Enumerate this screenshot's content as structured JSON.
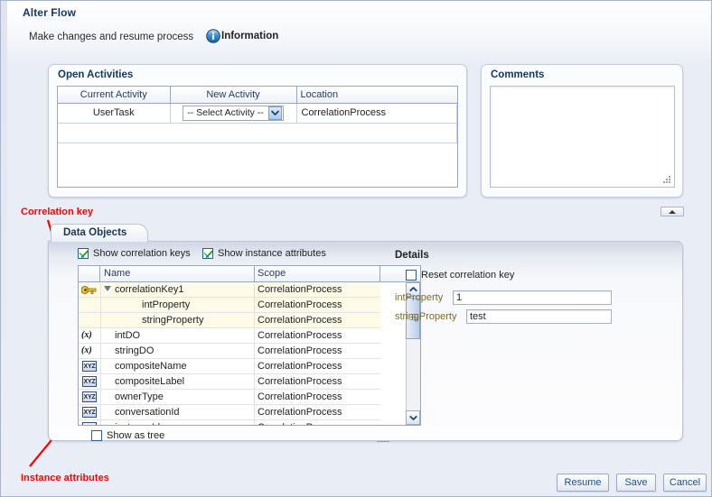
{
  "window": {
    "title": "Alter Flow",
    "subtitle": "Make changes and resume process",
    "info_label": "Information",
    "info_icon": "information-icon"
  },
  "open_activities": {
    "title": "Open Activities",
    "columns": [
      "Current Activity",
      "New Activity",
      "Location"
    ],
    "rows": [
      {
        "current_activity": "UserTask",
        "new_activity": "-- Select Activity --",
        "location": "CorrelationProcess"
      }
    ]
  },
  "comments": {
    "title": "Comments",
    "value": "",
    "placeholder": "",
    "resize_grip_icon": "resize-grip-icon"
  },
  "collapse_toggle": {
    "icon": "collapse-up-icon"
  },
  "data_objects": {
    "tab_label": "Data Objects",
    "show_correlation_keys": {
      "label": "Show correlation keys",
      "checked": true
    },
    "show_instance_attributes": {
      "label": "Show instance attributes",
      "checked": true
    },
    "show_as_tree": {
      "label": "Show as tree",
      "checked": false
    },
    "columns": [
      "Name",
      "Scope"
    ],
    "rows": [
      {
        "icon": "key-icon",
        "name": "correlationKey1",
        "scope": "CorrelationProcess",
        "indent": 0,
        "expanded": true,
        "highlight": true
      },
      {
        "icon": "none",
        "name": "intProperty",
        "scope": "CorrelationProcess",
        "indent": 1,
        "highlight": true
      },
      {
        "icon": "none",
        "name": "stringProperty",
        "scope": "CorrelationProcess",
        "indent": 1,
        "highlight": true
      },
      {
        "icon": "variable-x-icon",
        "name": "intDO",
        "scope": "CorrelationProcess",
        "indent": 0,
        "highlight": false
      },
      {
        "icon": "variable-x-icon",
        "name": "stringDO",
        "scope": "CorrelationProcess",
        "indent": 0,
        "highlight": false
      },
      {
        "icon": "xyz-string-icon",
        "name": "compositeName",
        "scope": "CorrelationProcess",
        "indent": 0,
        "highlight": false
      },
      {
        "icon": "xyz-string-icon",
        "name": "compositeLabel",
        "scope": "CorrelationProcess",
        "indent": 0,
        "highlight": false
      },
      {
        "icon": "xyz-string-icon",
        "name": "ownerType",
        "scope": "CorrelationProcess",
        "indent": 0,
        "highlight": false
      },
      {
        "icon": "xyz-string-icon",
        "name": "conversationId",
        "scope": "CorrelationProcess",
        "indent": 0,
        "highlight": false
      },
      {
        "icon": "xyz-string-icon",
        "name": "instanceId",
        "scope": "CorrelationProcess",
        "indent": 0,
        "highlight": false
      }
    ],
    "scrollbar": {
      "up_icon": "chevron-up-icon",
      "down_icon": "chevron-down-icon",
      "left_icon": "chevron-left-icon"
    }
  },
  "details": {
    "title": "Details",
    "reset_correlation_key": {
      "label": "Reset correlation key",
      "checked": false
    },
    "fields": [
      {
        "label": "intProperty",
        "value": "1"
      },
      {
        "label": "stringProperty",
        "value": "test"
      }
    ]
  },
  "footer": {
    "resume_label": "Resume",
    "save_label": "Save",
    "cancel_label": "Cancel"
  },
  "annotations": [
    {
      "text": "Correlation key"
    },
    {
      "text": "Instance attributes"
    }
  ],
  "colors": {
    "annotation_red": "#ff0000",
    "title_blue": "#14375e",
    "field_label_olive": "#7a6a2f",
    "highlight_row": "#fdfbe8",
    "button_text": "#1b4f8f"
  }
}
